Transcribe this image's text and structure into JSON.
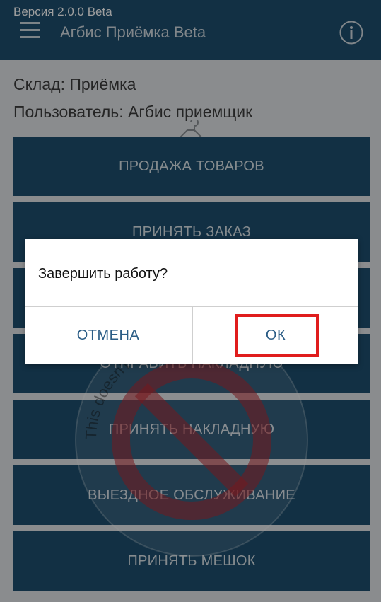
{
  "status": {
    "version": "Версия 2.0.0 Beta"
  },
  "appbar": {
    "title": "Агбис Приёмка Beta",
    "menu_icon": "menu-icon",
    "info_icon": "info-icon"
  },
  "info": {
    "warehouse": "Склад: Приёмка",
    "user": "Пользователь: Агбис приемщик"
  },
  "menu": {
    "items": [
      {
        "label": "ПРОДАЖА ТОВАРОВ"
      },
      {
        "label": "ПРИНЯТЬ ЗАКАЗ"
      },
      {
        "label": ""
      },
      {
        "label": "ОТПРАВИТЬ НАКЛАДНУЮ"
      },
      {
        "label": "ПРИНЯТЬ НАКЛАДНУЮ"
      },
      {
        "label": "ВЫЕЗДНОЕ ОБСЛУЖИВАНИЕ"
      },
      {
        "label": "ПРИНЯТЬ МЕШОК"
      }
    ]
  },
  "watermark": {
    "text": "This doesn't exist!! Don't do it!"
  },
  "dialog": {
    "message": "Завершить работу?",
    "cancel_label": "ОТМЕНА",
    "ok_label": "ОК"
  },
  "colors": {
    "primary": "#1d4e6e",
    "dialog_button": "#2b5d86",
    "highlight": "#e01d1d"
  }
}
